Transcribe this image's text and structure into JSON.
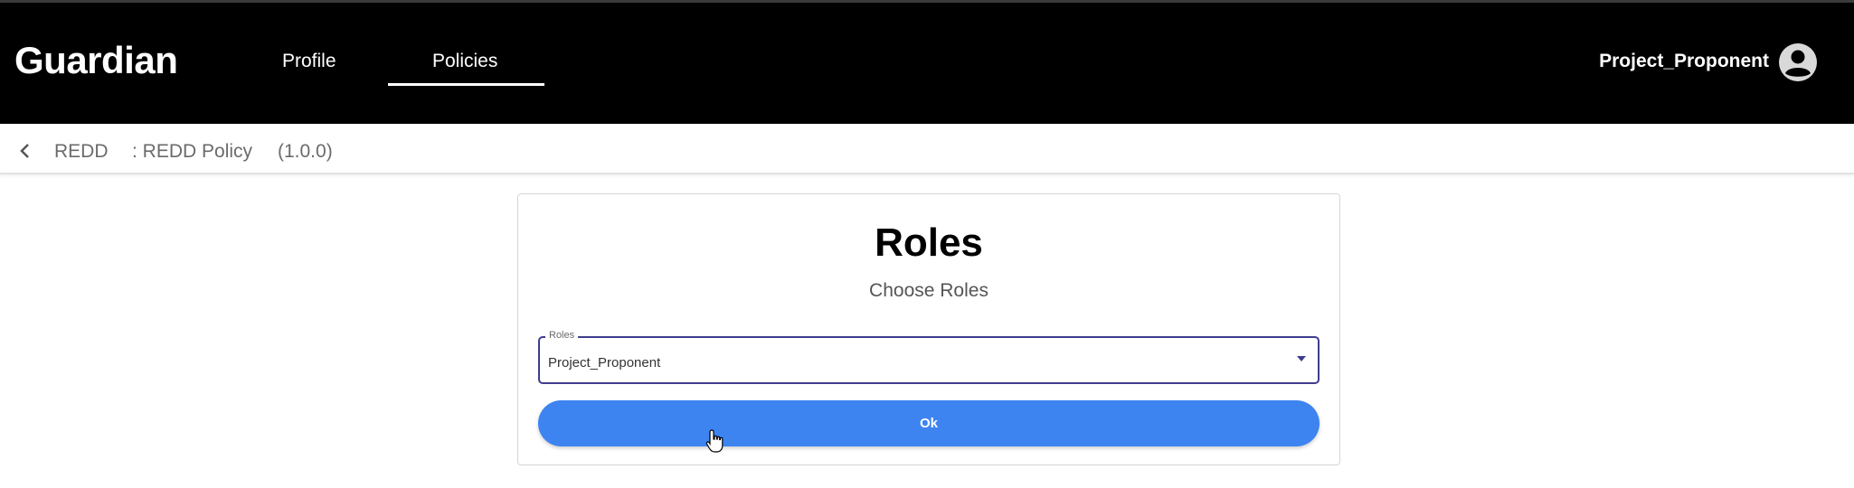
{
  "header": {
    "brand": "Guardian",
    "nav": [
      {
        "label": "Profile",
        "active": false
      },
      {
        "label": "Policies",
        "active": true
      }
    ],
    "user_name": "Project_Proponent",
    "avatar_icon": "account-circle-icon"
  },
  "breadcrumb": {
    "back_icon": "chevron-left-icon",
    "policy_tag": "REDD",
    "policy_name": ": REDD Policy",
    "version": "(1.0.0)"
  },
  "roles_card": {
    "title": "Roles",
    "subtitle": "Choose Roles",
    "select": {
      "label": "Roles",
      "value": "Project_Proponent"
    },
    "ok_label": "Ok"
  },
  "colors": {
    "topbar": "#000000",
    "select_border": "#3f3d8e",
    "button": "#3d84f0"
  }
}
